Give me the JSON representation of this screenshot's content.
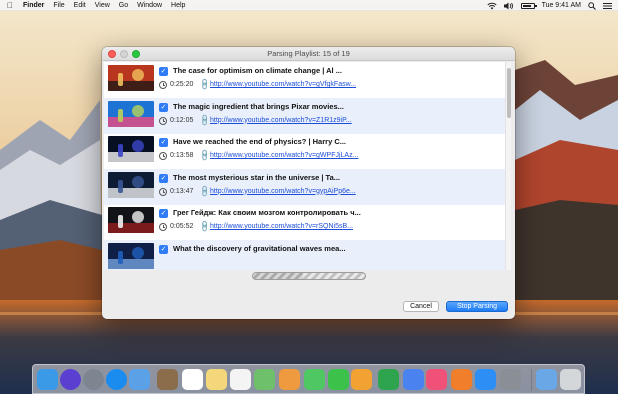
{
  "menubar": {
    "apple_icon": "apple-icon",
    "app_name": "Finder",
    "menus": [
      "File",
      "Edit",
      "View",
      "Go",
      "Window",
      "Help"
    ],
    "clock": "Tue 9:41 AM",
    "status_icons": [
      "wifi-icon",
      "volume-icon",
      "battery-icon",
      "search-icon",
      "list-icon"
    ],
    "battery_level": 0.85
  },
  "window": {
    "title": "Parsing Playlist: 15 of 19",
    "items": [
      {
        "title": "The case for optimism on climate change | Al ...",
        "duration": "0:25:20",
        "url": "http://www.youtube.com/watch?v=gVfgkFasw...",
        "checked": true,
        "thumb_colors": [
          "#b9361e",
          "#f0c15d",
          "#2a1a18"
        ]
      },
      {
        "title": "The magic ingredient that brings Pixar movies...",
        "duration": "0:12:05",
        "url": "http://www.youtube.com/watch?v=Z1R1z9iP...",
        "checked": true,
        "thumb_colors": [
          "#1d73d3",
          "#b8d35a",
          "#e24b84"
        ]
      },
      {
        "title": "Have we reached the end of physics? | Harry C...",
        "duration": "0:13:58",
        "url": "http://www.youtube.com/watch?v=gWPFJjLAz...",
        "checked": true,
        "thumb_colors": [
          "#061022",
          "#3c46c9",
          "#e6e6e6"
        ]
      },
      {
        "title": "The most mysterious star in the universe | Ta...",
        "duration": "0:13:47",
        "url": "http://www.youtube.com/watch?v=gypAiPp6e...",
        "checked": true,
        "thumb_colors": [
          "#0d1b35",
          "#3a5796",
          "#e0e0e0"
        ]
      },
      {
        "title": "Грег Гейдж: Как своим мозгом контролировать ч...",
        "duration": "0:05:52",
        "url": "http://www.youtube.com/watch?v=rSQNi5sB...",
        "checked": true,
        "thumb_colors": [
          "#111318",
          "#f1f1f1",
          "#8e1d1d"
        ]
      },
      {
        "title": "What the discovery of gravitational waves mea...",
        "duration": "",
        "url": "",
        "checked": true,
        "thumb_colors": [
          "#0f1f46",
          "#1f5fbd",
          "#6e9ad6"
        ]
      }
    ],
    "progress": 0.45,
    "cancel_label": "Cancel",
    "stop_label": "Stop Parsing"
  },
  "dock": {
    "apps": [
      {
        "name": "finder-icon",
        "color": "#3b9ae8"
      },
      {
        "name": "siri-icon",
        "color": "#5b3fd1"
      },
      {
        "name": "launchpad-icon",
        "color": "#7d8590"
      },
      {
        "name": "safari-icon",
        "color": "#1a8cf0"
      },
      {
        "name": "mail-icon",
        "color": "#5aa1e8"
      },
      {
        "name": "notes-icon",
        "color": "#8b6d4b"
      },
      {
        "name": "calendar-icon",
        "color": "#ffffff"
      },
      {
        "name": "notes-pad-icon",
        "color": "#f4d77a"
      },
      {
        "name": "reminders-icon",
        "color": "#f4f4f4"
      },
      {
        "name": "maps-icon",
        "color": "#6fc06b"
      },
      {
        "name": "photos-icon",
        "color": "#f09a3f"
      },
      {
        "name": "messages-icon",
        "color": "#4fc763"
      },
      {
        "name": "facetime-icon",
        "color": "#3cc14b"
      },
      {
        "name": "pages-icon",
        "color": "#f2a233"
      },
      {
        "name": "numbers-icon",
        "color": "#2ea44f"
      },
      {
        "name": "keynote-icon",
        "color": "#4a82f0"
      },
      {
        "name": "music-icon",
        "color": "#f05178"
      },
      {
        "name": "books-icon",
        "color": "#f07e2b"
      },
      {
        "name": "app-store-icon",
        "color": "#2d8ef5"
      },
      {
        "name": "system-preferences-icon",
        "color": "#8a8f96"
      },
      {
        "name": "downloads-folder-icon",
        "color": "#6aa7e6"
      },
      {
        "name": "trash-icon",
        "color": "#d4d7da"
      }
    ]
  }
}
